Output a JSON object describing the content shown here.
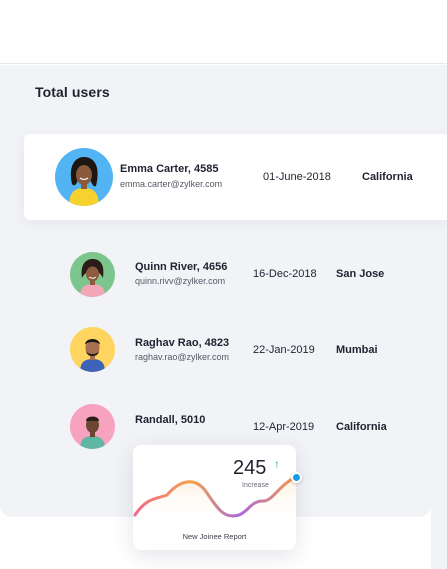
{
  "page": {
    "title": "Total users"
  },
  "users": [
    {
      "name": "Emma Carter, 4585",
      "email": "emma.carter@zylker.com",
      "date": "01-June-2018",
      "city": "California",
      "avatar_bg": "#52b4f2",
      "highlighted": true
    },
    {
      "name": "Quinn River, 4656",
      "email": "quinn.rivv@zylker.com",
      "date": "16-Dec-2018",
      "city": "San Jose",
      "avatar_bg": "#7cc58d"
    },
    {
      "name": "Raghav Rao, 4823",
      "email": "raghav.rao@zylker.com",
      "date": "22-Jan-2019",
      "city": "Mumbai",
      "avatar_bg": "#ffd560"
    },
    {
      "name": "Randall, 5010",
      "email": "",
      "date": "12-Apr-2019",
      "city": "California",
      "avatar_bg": "#f7a3bf"
    }
  ],
  "report": {
    "value": "245",
    "trend_icon": "arrow-up-icon",
    "trend_symbol": "↑",
    "subtitle": "Increase",
    "title": "New Joinee Report"
  },
  "colors": {
    "panel_bg": "#f2f3f6",
    "accent_blue": "#1a9be6",
    "trend_green": "#2fb39a",
    "line_gradient": [
      "#f26a8d",
      "#f4a24b",
      "#a86ad8",
      "#f49a4b"
    ]
  }
}
